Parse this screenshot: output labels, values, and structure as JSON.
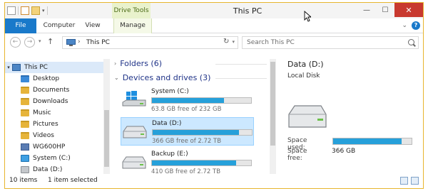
{
  "window": {
    "title": "This PC",
    "controls": {
      "minimize": "—",
      "maximize": "☐",
      "close": "✕"
    }
  },
  "quick_access": {
    "dropdown": "▾"
  },
  "ribbon": {
    "context_tab": "Drive Tools",
    "tabs": {
      "file": "File",
      "computer": "Computer",
      "view": "View",
      "manage": "Manage"
    },
    "expand_chevron": "⌄",
    "help": "?"
  },
  "navigation": {
    "back": "←",
    "forward": "→",
    "history_dropdown": "▾",
    "up": "↑",
    "breadcrumb_separator": "›",
    "location": "This PC",
    "address_dropdown": "▾",
    "refresh": "↻"
  },
  "search": {
    "placeholder": "Search This PC"
  },
  "nav_pane": {
    "items": [
      {
        "label": "This PC",
        "icon": "pc-icon",
        "expander": "▾"
      },
      {
        "label": "Desktop",
        "icon": "folder-icon"
      },
      {
        "label": "Documents",
        "icon": "folder-icon"
      },
      {
        "label": "Downloads",
        "icon": "folder-icon"
      },
      {
        "label": "Music",
        "icon": "folder-icon"
      },
      {
        "label": "Pictures",
        "icon": "folder-icon"
      },
      {
        "label": "Videos",
        "icon": "folder-icon"
      },
      {
        "label": "WG600HP",
        "icon": "network-drive-icon"
      },
      {
        "label": "System (C:)",
        "icon": "windows-drive-icon"
      },
      {
        "label": "Data (D:)",
        "icon": "drive-icon"
      }
    ]
  },
  "content": {
    "folders_group": {
      "label": "Folders (6)",
      "arrow": "›"
    },
    "devices_group": {
      "label": "Devices and drives (3)",
      "arrow": "⌄"
    },
    "drives": [
      {
        "name": "System (C:)",
        "free_text": "63.8 GB free of 232 GB",
        "used_fraction": 0.73,
        "icon": "windows-drive-icon"
      },
      {
        "name": "Data (D:)",
        "free_text": "366 GB free of 2.72 TB",
        "used_fraction": 0.87,
        "icon": "drive-icon"
      },
      {
        "name": "Backup (E:)",
        "free_text": "410 GB free of 2.72 TB",
        "used_fraction": 0.85,
        "icon": "drive-icon"
      }
    ]
  },
  "details": {
    "title": "Data (D:)",
    "subtitle": "Local Disk",
    "space_used_label": "Space used:",
    "space_used_fraction": 0.87,
    "space_free_label": "Space free:",
    "space_free_value": "366 GB"
  },
  "status_bar": {
    "items_count": "10 items",
    "selected": "1 item selected"
  },
  "colors": {
    "accent": "#1979ca",
    "context_tab_bg": "#e9f2cc",
    "progress_fill": "#26a0da",
    "selection_bg": "#cce8ff",
    "close_button": "#c8392f",
    "window_border": "#e7b52e"
  }
}
